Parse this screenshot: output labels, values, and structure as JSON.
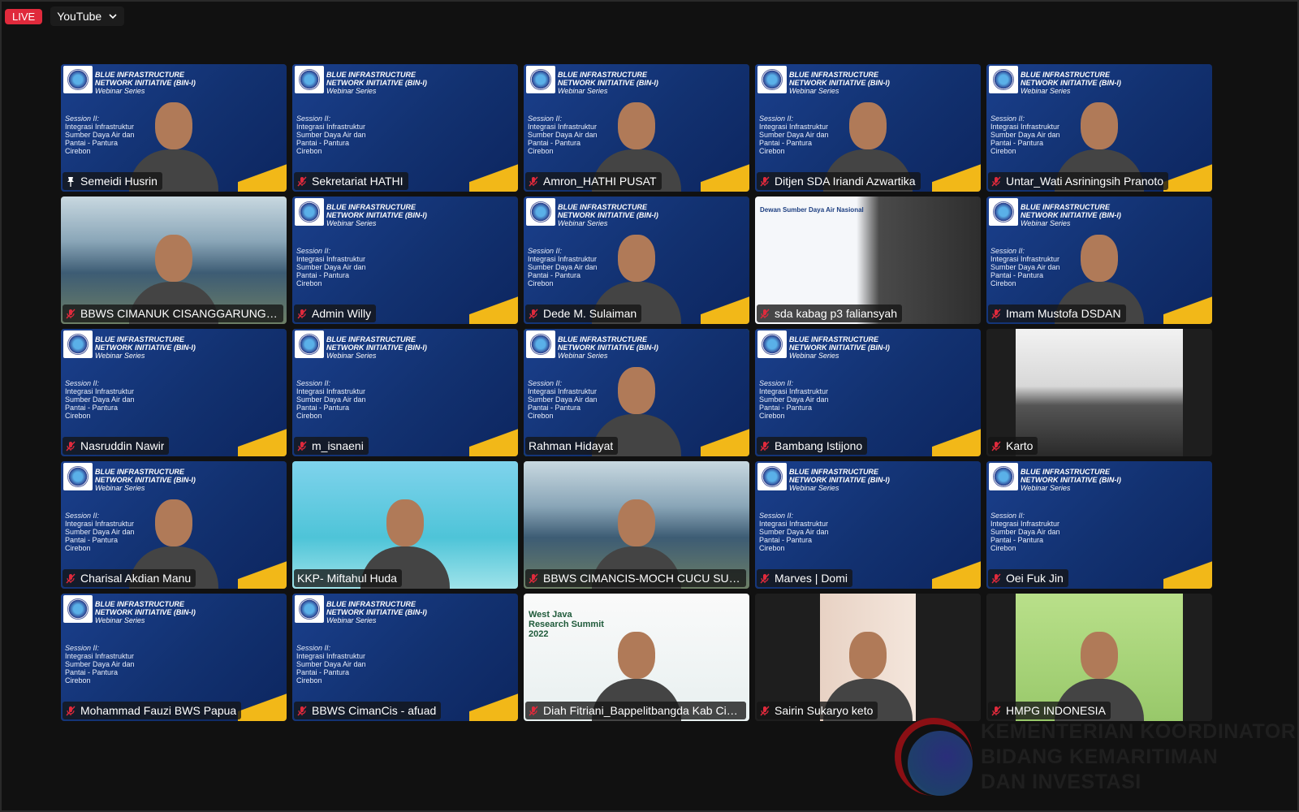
{
  "topbar": {
    "live_label": "LIVE",
    "stream_target": "YouTube"
  },
  "colors": {
    "live": "#e02a3c",
    "active_speaker": "#3ed13e",
    "muted_icon": "#e02a3c",
    "slide_blue": "#123170",
    "slide_yellow": "#f2b818"
  },
  "slide": {
    "title": "BLUE INFRASTRUCTURE NETWORK INITIATIVE (BIN-I)",
    "subtitle": "Webinar Series",
    "session": "Session II:",
    "lines": [
      "Integrasi Infrastruktur",
      "Sumber Daya Air dan",
      "Pantai - Pantura",
      "Cirebon"
    ]
  },
  "poster": {
    "title": "West Java Research Summit 2022"
  },
  "council": {
    "title": "Dewan Sumber Daya Air Nasional"
  },
  "participants": [
    {
      "name": "Semeidi Husrin",
      "bg": "slide",
      "icon": "pin-icon"
    },
    {
      "name": "Sekretariat HATHI",
      "bg": "slide",
      "icon": "mic-muted-icon",
      "noperson": true
    },
    {
      "name": "Amron_HATHI PUSAT",
      "bg": "slide",
      "icon": "mic-muted-icon"
    },
    {
      "name": "Ditjen SDA Iriandi Azwartika",
      "bg": "slide",
      "icon": "mic-muted-icon"
    },
    {
      "name": "Untar_Wati Asriningsih Pranoto",
      "bg": "slide",
      "icon": "mic-muted-icon"
    },
    {
      "name": "BBWS CIMANUK CISANGGARUNG - IS...",
      "bg": "photo-water",
      "icon": "mic-muted-icon"
    },
    {
      "name": "Admin Willy",
      "bg": "slide",
      "icon": "mic-muted-icon",
      "noperson": true
    },
    {
      "name": "Dede M. Sulaiman",
      "bg": "slide",
      "icon": "mic-muted-icon"
    },
    {
      "name": "sda kabag p3 faliansyah",
      "bg": "council",
      "icon": "mic-muted-icon",
      "noperson": true
    },
    {
      "name": "Imam Mustofa DSDAN",
      "bg": "slide",
      "icon": "mic-muted-icon"
    },
    {
      "name": "Nasruddin Nawir",
      "bg": "slide",
      "icon": "mic-muted-icon",
      "noperson": true
    },
    {
      "name": "m_isnaeni",
      "bg": "slide",
      "icon": "mic-muted-icon",
      "noperson": true
    },
    {
      "name": "Rahman Hidayat",
      "bg": "slide",
      "icon": "none",
      "active": true
    },
    {
      "name": "Bambang Istijono",
      "bg": "slide",
      "icon": "mic-muted-icon",
      "noperson": true
    },
    {
      "name": "Karto",
      "bg": "photo-dark",
      "icon": "mic-muted-icon",
      "noperson": true
    },
    {
      "name": "Charisal Akdian Manu",
      "bg": "slide",
      "icon": "mic-muted-icon"
    },
    {
      "name": "KKP- Miftahul Huda",
      "bg": "photo-sky",
      "icon": "none"
    },
    {
      "name": "BBWS CIMANCIS-MOCH CUCU SUDIAN",
      "bg": "photo-water",
      "icon": "mic-muted-icon"
    },
    {
      "name": "Marves | Domi",
      "bg": "slide",
      "icon": "mic-muted-icon",
      "noperson": true
    },
    {
      "name": "Oei Fuk Jin",
      "bg": "slide",
      "icon": "mic-muted-icon",
      "noperson": true
    },
    {
      "name": "Mohammad Fauzi BWS Papua",
      "bg": "slide",
      "icon": "mic-muted-icon",
      "noperson": true
    },
    {
      "name": "BBWS CimanCis - afuad",
      "bg": "slide",
      "icon": "mic-muted-icon",
      "noperson": true
    },
    {
      "name": "Diah Fitriani_Bappelitbangda Kab Cire...",
      "bg": "poster",
      "icon": "mic-muted-icon"
    },
    {
      "name": "Sairin Sukaryo keto",
      "bg": "photo-room",
      "icon": "mic-muted-icon"
    },
    {
      "name": "HMPG INDONESIA",
      "bg": "photo-green",
      "icon": "mic-muted-icon"
    }
  ],
  "watermark": {
    "lines": [
      "KEMENTERIAN KOORDINATOR",
      "BIDANG KEMARITIMAN",
      "DAN INVESTASI"
    ]
  }
}
